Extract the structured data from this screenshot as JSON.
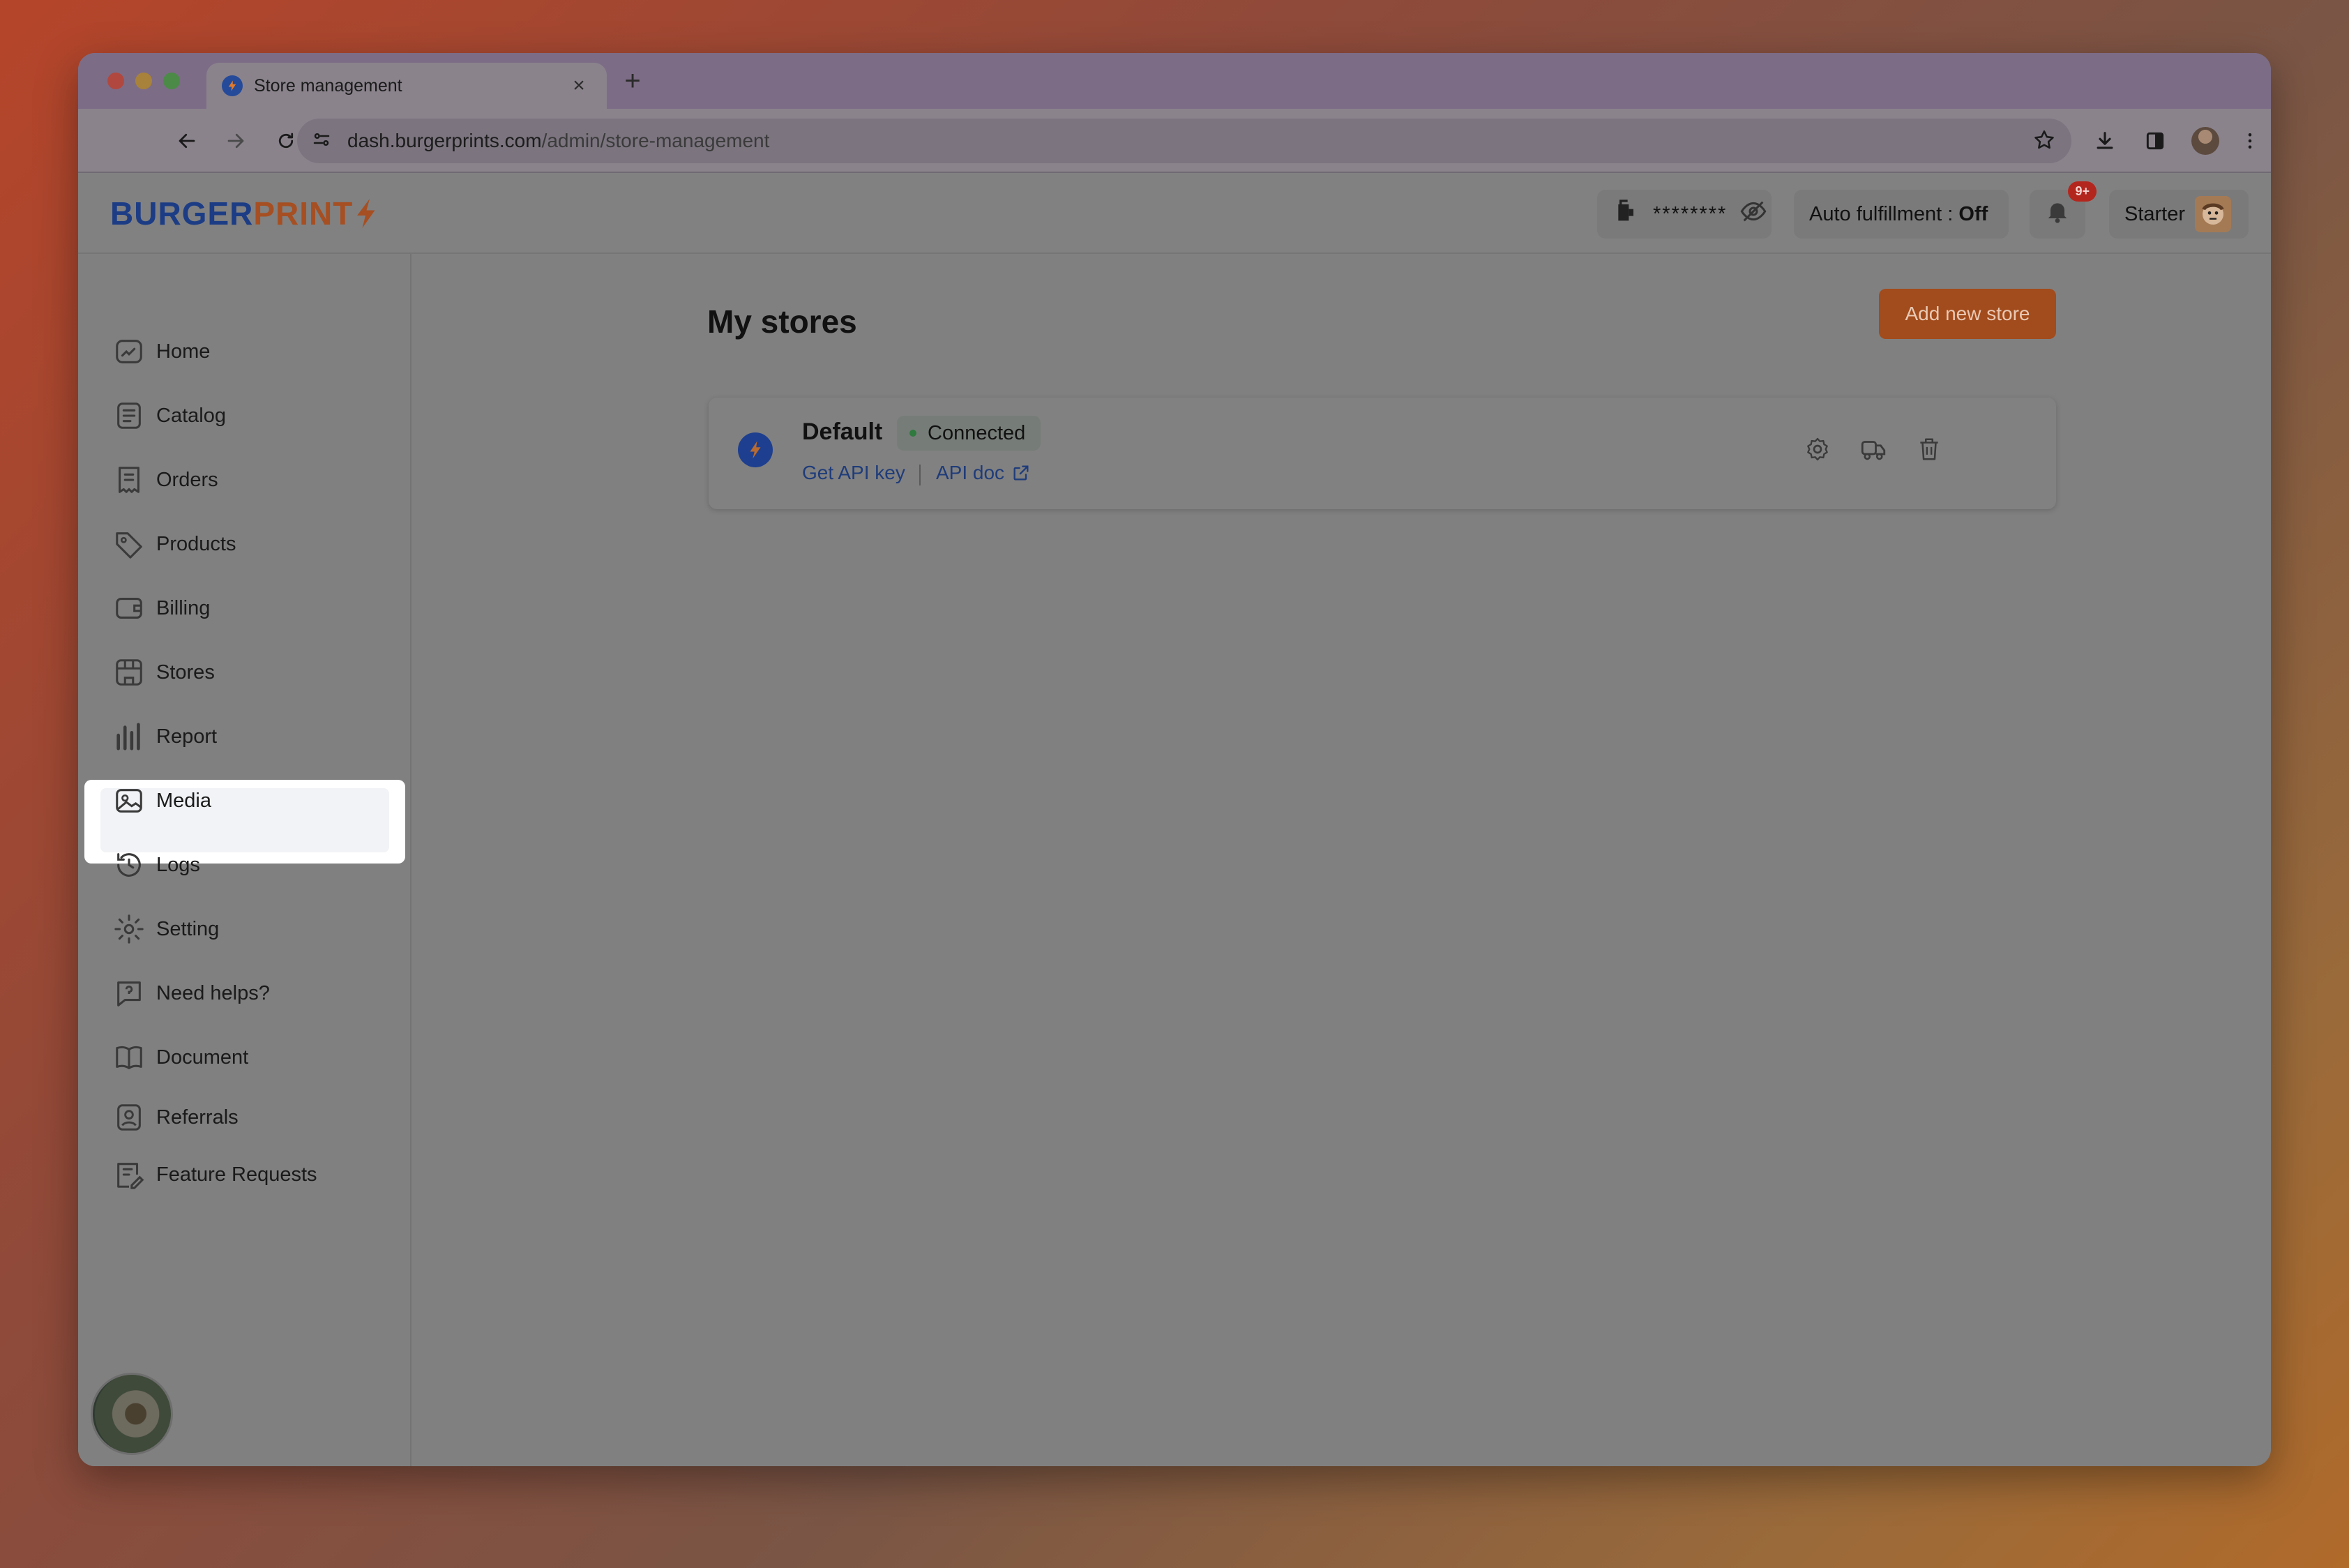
{
  "browser": {
    "tab_title": "Store management",
    "tab_close": "×",
    "new_tab": "+",
    "url_domain": "dash.burgerprints.com",
    "url_path": "/admin/store-management"
  },
  "header": {
    "logo_part1": "BURGER",
    "logo_part2": "PRINT",
    "balance_masked": "********",
    "auto_fulfillment_label": "Auto fulfillment : ",
    "auto_fulfillment_value": "Off",
    "notification_badge": "9+",
    "plan": "Starter"
  },
  "sidebar": {
    "items": [
      {
        "label": "Home",
        "icon": "home-chart-icon"
      },
      {
        "label": "Catalog",
        "icon": "catalog-icon"
      },
      {
        "label": "Orders",
        "icon": "orders-icon"
      },
      {
        "label": "Products",
        "icon": "tag-icon"
      },
      {
        "label": "Billing",
        "icon": "wallet-icon"
      },
      {
        "label": "Stores",
        "icon": "store-icon",
        "active": true
      },
      {
        "label": "Report",
        "icon": "bar-chart-icon"
      },
      {
        "label": "Media",
        "icon": "image-icon"
      },
      {
        "label": "Logs",
        "icon": "history-icon"
      },
      {
        "label": "Setting",
        "icon": "gear-icon"
      },
      {
        "label": "Need helps?",
        "icon": "help-icon"
      },
      {
        "label": "Document",
        "icon": "book-icon"
      },
      {
        "label": "Referrals",
        "icon": "referral-icon"
      },
      {
        "label": "Feature Requests",
        "icon": "feature-request-icon"
      }
    ]
  },
  "main": {
    "title": "My stores",
    "add_button": "Add new store",
    "stores": [
      {
        "name": "Default",
        "status": "Connected",
        "link_api_key": "Get API key",
        "link_api_doc": "API doc"
      }
    ]
  },
  "colors": {
    "accent": "#a24b1c",
    "brand_blue": "#1c3d85",
    "link": "#1f3c7a",
    "status_connected": "#2f7a3e"
  }
}
